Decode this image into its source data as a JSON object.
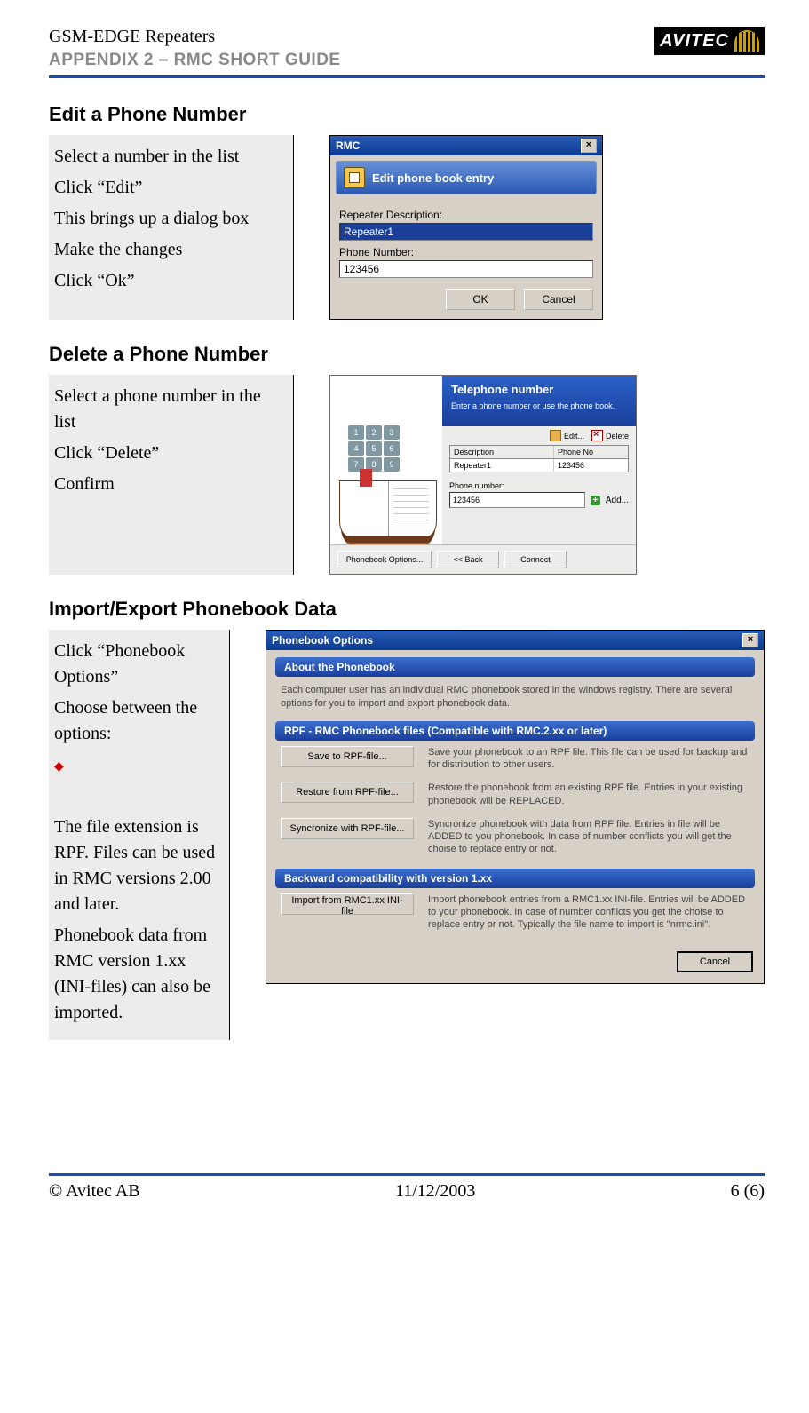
{
  "header": {
    "title": "GSM-EDGE Repeaters",
    "subtitle": "APPENDIX 2 – RMC SHORT GUIDE",
    "logo_text": "AVITEC"
  },
  "sections": {
    "edit": {
      "title": "Edit a Phone Number",
      "steps": [
        "Select a number in the list",
        "Click “Edit”",
        "This brings up a dialog box",
        "Make the changes",
        "Click “Ok”"
      ],
      "dialog": {
        "window_title": "RMC",
        "banner": "Edit phone book entry",
        "label_desc": "Repeater Description:",
        "value_desc": "Repeater1",
        "label_num": "Phone Number:",
        "value_num": "123456",
        "ok": "OK",
        "cancel": "Cancel"
      }
    },
    "delete": {
      "title": "Delete a Phone Number",
      "steps": [
        "Select a phone number in the list",
        "Click “Delete”",
        "Confirm"
      ],
      "dialog": {
        "banner_title": "Telephone number",
        "banner_sub": "Enter a phone number or use the phone book.",
        "keypad": [
          "1",
          "2",
          "3",
          "4",
          "5",
          "6",
          "7",
          "8",
          "9"
        ],
        "tool_edit": "Edit...",
        "tool_delete": "Delete",
        "th_desc": "Description",
        "th_num": "Phone No",
        "row_desc": "Repeater1",
        "row_num": "123456",
        "num_label": "Phone number:",
        "num_value": "123456",
        "add": "Add...",
        "btn_options": "Phonebook Options...",
        "btn_back": "<< Back",
        "btn_connect": "Connect"
      }
    },
    "import": {
      "title": "Import/Export Phonebook Data",
      "steps_a": [
        "Click “Phonebook Options”",
        "Choose between the options:"
      ],
      "note1": "The file extension is RPF. Files can be used in RMC versions 2.00 and later.",
      "note2": "Phonebook data from RMC version 1.xx (INI-files) can also be imported.",
      "dialog": {
        "window_title": "Phonebook Options",
        "h_about": "About the Phonebook",
        "about_text": "Each computer user has an individual RMC phonebook stored in the windows registry. There are several options for you to import and export phonebook data.",
        "h_rpf": "RPF - RMC Phonebook files (Compatible with RMC.2.xx or later)",
        "rows": [
          {
            "btn": "Save to RPF-file...",
            "desc": "Save your phonebook to an RPF file. This file can be used for backup and for distribution to other users."
          },
          {
            "btn": "Restore from RPF-file...",
            "desc": "Restore the phonebook from an existing RPF file. Entries in your existing phonebook will be REPLACED."
          },
          {
            "btn": "Syncronize with RPF-file...",
            "desc": "Syncronize phonebook with data from RPF file. Entries in file will be ADDED to you phonebook. In case of number conflicts you will get the choise to replace entry or not."
          }
        ],
        "h_back": "Backward compatibility with version 1.xx",
        "row_back": {
          "btn": "Import from RMC1.xx INI-file",
          "desc": "Import phonebook entries from a RMC1.xx INI-file. Entries will be ADDED to your phonebook. In case of number conflicts you get the choise to replace entry or not. Typically the file name to import is \"nrmc.ini\"."
        },
        "cancel": "Cancel"
      }
    }
  },
  "footer": {
    "left": "© Avitec AB",
    "center": "11/12/2003",
    "right": "6 (6)"
  }
}
